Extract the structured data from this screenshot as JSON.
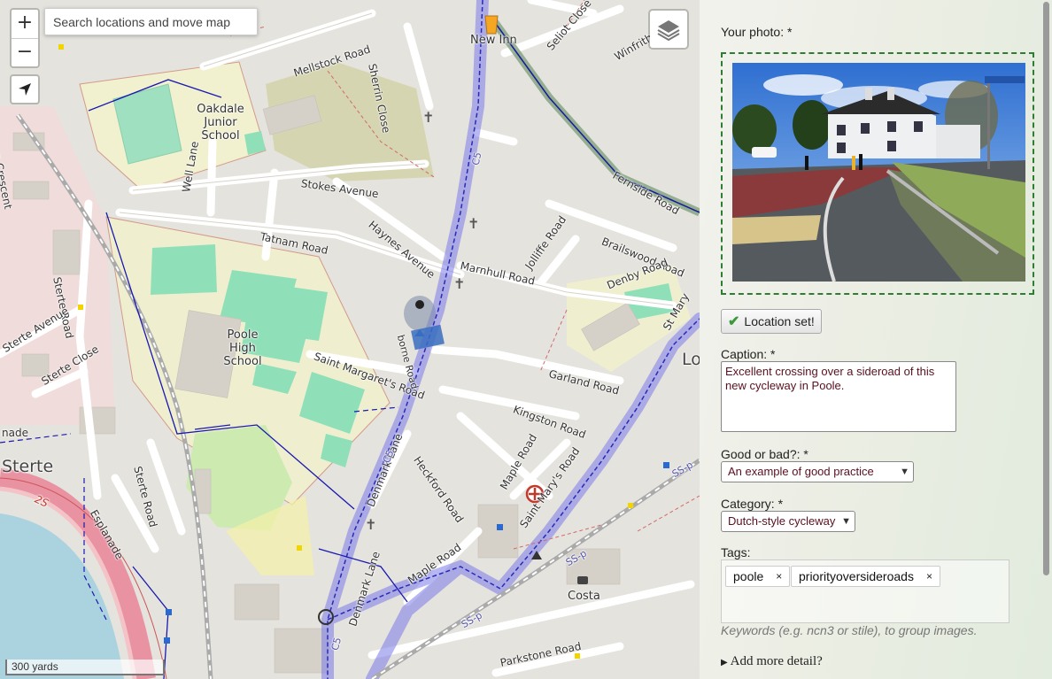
{
  "map": {
    "zoom_in": "+",
    "zoom_out": "−",
    "search_placeholder": "Search locations and move map",
    "scale": "300 yards",
    "labels": {
      "new_inn": "New Inn",
      "mellstock": "Mellstock Road",
      "sherrin": "Sherrin Close",
      "seliot": "Seliot Close",
      "winfrith": "Winfrith",
      "fernside": "Fernside Road",
      "oakdale": "Oakdale Junior School",
      "stanley": "Stanley Green Crescent",
      "stokes": "Stokes Avenue",
      "well": "Well Lane",
      "haynes": "Haynes Avenue",
      "brailswood": "Brailswood Road",
      "tatnam": "Tatnam Road",
      "marnhull": "Marnhull Road",
      "jolliffe": "Jolliffe Road",
      "denby": "Denby Road",
      "sterte_rd": "Sterte Road",
      "sterte_ave": "Sterte Avenue",
      "poole_high": "Poole High School",
      "st_margaret": "Saint Margaret's Road",
      "garland": "Garland Road",
      "st_mary": "St Mary",
      "lo": "Lo",
      "sterte_close": "Sterte Close",
      "kingston": "Kingston Road",
      "heckford": "Heckford Road",
      "denmark": "Denmark Lane",
      "maple": "Maple Road",
      "st_marys": "Saint Mary's Road",
      "sterte_big": "Sterte",
      "sterte_rd2": "Sterte Road",
      "esplanade": "Esplanade",
      "costa": "Costa",
      "parkstone": "Parkstone Road",
      "c5a": "C5",
      "c5b": "C5",
      "c5c": "C5",
      "r2s": "2S",
      "ss_p1": "SS-p",
      "ss_p2": "SS-p",
      "ss_p3": "SS-p",
      "nade": "nade",
      "sbrne": "borne Road"
    },
    "colors": {
      "water": "#aad3df",
      "grass": "#cdebb0",
      "pitch": "#88e0be",
      "school": "#efefd0",
      "residential": "#e0dfdf",
      "route": "#6b6bdc",
      "road_red": "#e892a2"
    }
  },
  "form": {
    "photo_label": "Your photo: *",
    "location_button": "Location set!",
    "caption_label": "Caption: *",
    "caption_value": "Excellent crossing over a sideroad of this new cycleway in Poole.",
    "good_bad_label": "Good or bad?: *",
    "good_bad_value": "An example of good practice",
    "category_label": "Category: *",
    "category_value": "Dutch-style cycleway",
    "tags_label": "Tags:",
    "tags": [
      {
        "label": "poole",
        "remove": "×"
      },
      {
        "label": "priorityoversideroads",
        "remove": "×"
      }
    ],
    "tags_hint": "Keywords (e.g. ncn3 or stile), to group images.",
    "more_detail": "Add more detail?",
    "accent_border": "#2e7d32"
  }
}
